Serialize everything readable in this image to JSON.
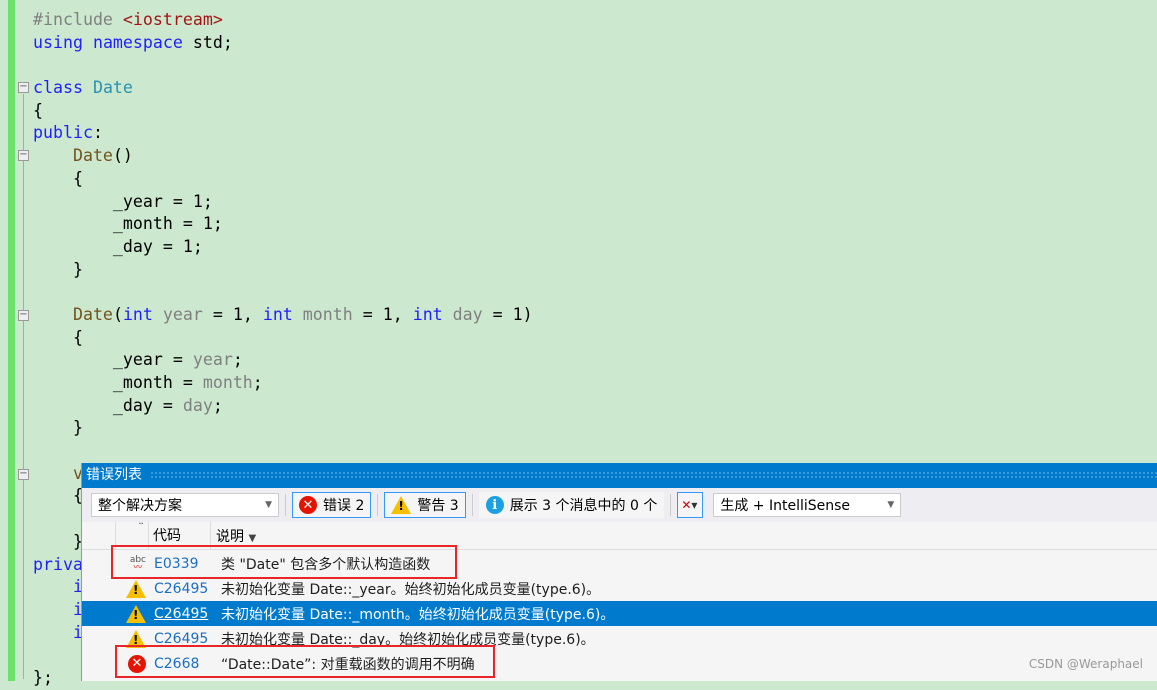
{
  "code_lines": [
    [
      [
        "pp",
        "#include "
      ],
      [
        "st",
        "<iostream>"
      ]
    ],
    [
      [
        "kw",
        "using "
      ],
      [
        "kw",
        "namespace "
      ],
      [
        "",
        "std;"
      ]
    ],
    [],
    [
      [
        "kw",
        "class "
      ],
      [
        "ty",
        "Date"
      ]
    ],
    [
      [
        "",
        "{"
      ]
    ],
    [
      [
        "kw",
        "public"
      ],
      [
        "",
        ":"
      ]
    ],
    [
      [
        "fn",
        "    Date"
      ],
      [
        "",
        "()"
      ]
    ],
    [
      [
        "",
        "    {"
      ]
    ],
    [
      [
        "",
        "        _year = 1;"
      ]
    ],
    [
      [
        "",
        "        _month = 1;"
      ]
    ],
    [
      [
        "",
        "        _day = 1;"
      ]
    ],
    [
      [
        "",
        "    }"
      ]
    ],
    [],
    [
      [
        "fn",
        "    Date"
      ],
      [
        "",
        "("
      ],
      [
        "kw",
        "int "
      ],
      [
        "pa",
        "year"
      ],
      [
        "",
        " = 1, "
      ],
      [
        "kw",
        "int "
      ],
      [
        "pa",
        "month"
      ],
      [
        "",
        " = 1, "
      ],
      [
        "kw",
        "int "
      ],
      [
        "pa",
        "day"
      ],
      [
        "",
        " = 1)"
      ]
    ],
    [
      [
        "",
        "    {"
      ]
    ],
    [
      [
        "",
        "        _year = "
      ],
      [
        "pa",
        "year"
      ],
      [
        "",
        ";"
      ]
    ],
    [
      [
        "",
        "        _month = "
      ],
      [
        "pa",
        "month"
      ],
      [
        "",
        ";"
      ]
    ],
    [
      [
        "",
        "        _day = "
      ],
      [
        "pa",
        "day"
      ],
      [
        "",
        ";"
      ]
    ],
    [
      [
        "",
        "    }"
      ]
    ],
    [],
    [
      [
        "fn",
        "    v"
      ]
    ],
    [
      [
        "",
        "    {"
      ]
    ],
    [],
    [
      [
        "",
        "    }"
      ]
    ],
    [
      [
        "kw",
        "priva"
      ]
    ],
    [
      [
        "kw",
        "    i"
      ]
    ],
    [
      [
        "kw",
        "    i"
      ]
    ],
    [
      [
        "kw",
        "    i"
      ]
    ],
    [],
    [
      [
        "",
        "};"
      ]
    ]
  ],
  "error_list": {
    "title": "错误列表",
    "scope": "整个解决方案",
    "errors_label": "错误 2",
    "warnings_label": "警告 3",
    "messages_label": "展示 3 个消息中的 0 个",
    "source": "生成 + IntelliSense",
    "columns": {
      "code": "代码",
      "description": "说明"
    },
    "rows": [
      {
        "icon": "spell-error-icon",
        "code": "E0339",
        "description": "类 \"Date\" 包含多个默认构造函数"
      },
      {
        "icon": "warning-icon",
        "code": "C26495",
        "description": "未初始化变量 Date::_year。始终初始化成员变量(type.6)。"
      },
      {
        "icon": "warning-icon",
        "code": "C26495",
        "description": "未初始化变量 Date::_month。始终初始化成员变量(type.6)。",
        "selected": true
      },
      {
        "icon": "warning-icon",
        "code": "C26495",
        "description": "未初始化变量 Date::_day。始终初始化成员变量(type.6)。"
      },
      {
        "icon": "error-icon",
        "code": "C2668",
        "description": "“Date::Date”: 对重载函数的调用不明确"
      }
    ]
  },
  "watermark": "CSDN @Weraphael",
  "colors": {
    "editor_bg": "#cce8cf",
    "accent": "#007acc",
    "highlight_box": "#e8262a"
  }
}
